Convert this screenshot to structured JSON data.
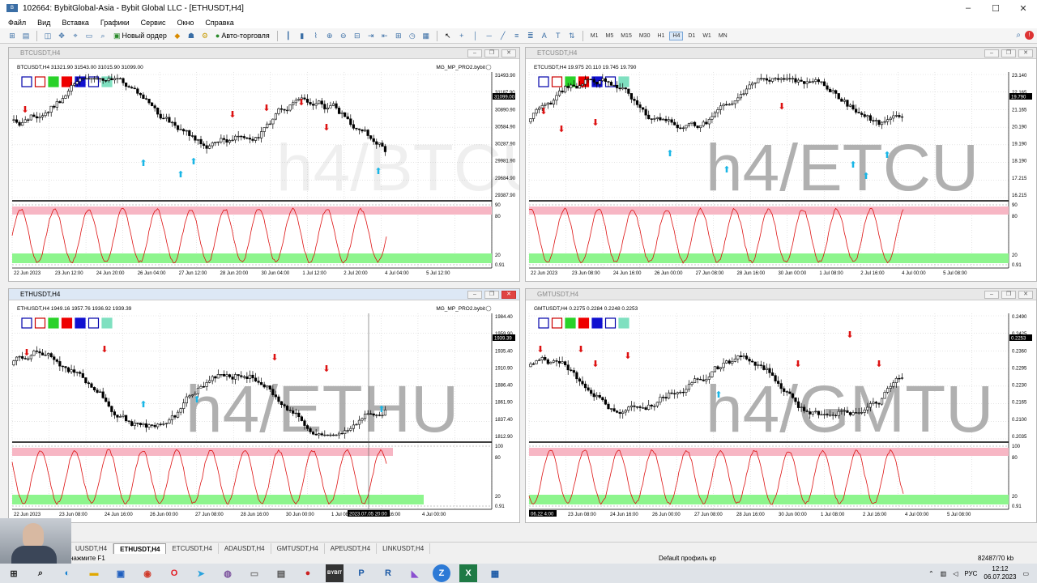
{
  "window": {
    "title": "102664: BybitGlobal-Asia - Bybit Global LLC - [ETHUSDT,H4]",
    "controls": [
      "–",
      "☐",
      "✕"
    ]
  },
  "menu": [
    "Файл",
    "Вид",
    "Вставка",
    "Графики",
    "Сервис",
    "Окно",
    "Справка"
  ],
  "toolbar": {
    "new_order": "Новый ордер",
    "auto_trading": "Авто-торговля",
    "timeframes": [
      "M1",
      "M5",
      "M15",
      "M30",
      "H1",
      "H4",
      "D1",
      "W1",
      "MN"
    ],
    "active_timeframe": "H4"
  },
  "charts": [
    {
      "id": "btc",
      "window_title": "BTCUSDT,H4",
      "info": "BTCUSDT,H4  31321.90 31543.00 31015.90 31099.00",
      "indicator": "MG_MP_PRO2.bybit",
      "watermark": "h4/BTCU",
      "price_labels": [
        "31493.90",
        "31187.90",
        "30890.90",
        "30584.90",
        "30287.90",
        "29981.90",
        "29684.90",
        "29387.90"
      ],
      "current_price": "31099.00",
      "osc_labels": [
        "90",
        "80",
        "20",
        "0.91"
      ],
      "dates": [
        "22 Jun 2023",
        "23 Jun 12:00",
        "24 Jun 20:00",
        "26 Jun 04:00",
        "27 Jun 12:00",
        "28 Jun 20:00",
        "30 Jun 04:00",
        "1 Jul 12:00",
        "2 Jul 20:00",
        "4 Jul 04:00",
        "5 Jul 12:00"
      ],
      "active": false
    },
    {
      "id": "etc",
      "window_title": "ETCUSDT,H4",
      "info": "ETCUSDT,H4  19.975 20.110 19.745 19.790",
      "indicator": "",
      "watermark": "h4/ETCU",
      "price_labels": [
        "23.140",
        "22.165",
        "21.165",
        "20.190",
        "19.190",
        "18.190",
        "17.215",
        "16.215"
      ],
      "current_price": "19.790",
      "osc_labels": [
        "90",
        "80",
        "20",
        "0.91"
      ],
      "dates": [
        "22 Jun 2023",
        "23 Jun 08:00",
        "24 Jun 16:00",
        "26 Jun 00:00",
        "27 Jun 08:00",
        "28 Jun 16:00",
        "30 Jun 00:00",
        "1 Jul 08:00",
        "2 Jul 16:00",
        "4 Jul 00:00",
        "5 Jul 08:00"
      ],
      "active": false
    },
    {
      "id": "eth",
      "window_title": "ETHUSDT,H4",
      "info": "ETHUSDT,H4  1949.16 1957.76 1936.92 1939.39",
      "indicator": "MG_MP_PRO2.bybit",
      "watermark": "h4/ETHU",
      "price_labels": [
        "1984.40",
        "1959.90",
        "1935.40",
        "1910.90",
        "1886.40",
        "1861.90",
        "1837.40",
        "1812.90"
      ],
      "current_price": "1939.39",
      "osc_labels": [
        "100",
        "80",
        "20",
        "0.91"
      ],
      "dates": [
        "22 Jun 2023",
        "23 Jun 08:00",
        "24 Jun 16:00",
        "26 Jun 00:00",
        "27 Jun 08:00",
        "28 Jun 16:00",
        "30 Jun 00:00",
        "1 Jul 08:00",
        "2 Jul 16:00",
        "4 Jul 00:00"
      ],
      "crosshair_date": "2023.07.05 20:00",
      "active": true
    },
    {
      "id": "gmt",
      "window_title": "GMTUSDT,H4",
      "info": "GMTUSDT,H4  0.2275 0.2284 0.2248 0.2253",
      "indicator": "",
      "watermark": "h4/GMTU",
      "price_labels": [
        "0.2490",
        "0.2425",
        "0.2360",
        "0.2295",
        "0.2230",
        "0.2165",
        "0.2100",
        "0.2035"
      ],
      "current_price": "0.2253",
      "osc_labels": [
        "100",
        "80",
        "20",
        "0.91"
      ],
      "dates": [
        "23 Jun 08:00",
        "24 Jun 16:00",
        "26 Jun 00:00",
        "27 Jun 08:00",
        "28 Jun 16:00",
        "30 Jun 00:00",
        "1 Jul 08:00",
        "2 Jul 16:00",
        "4 Jul 00:00",
        "5 Jul 08:00"
      ],
      "first_date": "06.22 4:00",
      "active": false
    }
  ],
  "tabs": [
    "UUSDT,H4",
    "ETHUSDT,H4",
    "ETCUSDT,H4",
    "ADAUSDT,H4",
    "GMTUSDT,H4",
    "APEUSDT,H4",
    "LINKUSDT,H4"
  ],
  "active_tab": "ETHUSDT,H4",
  "status": {
    "help": "нажмите F1",
    "profile": "Default профиль кр",
    "traffic": "82487/70 kb"
  },
  "taskbar": {
    "lang": "РУС",
    "time": "12:12",
    "date": "06.07.2023"
  }
}
